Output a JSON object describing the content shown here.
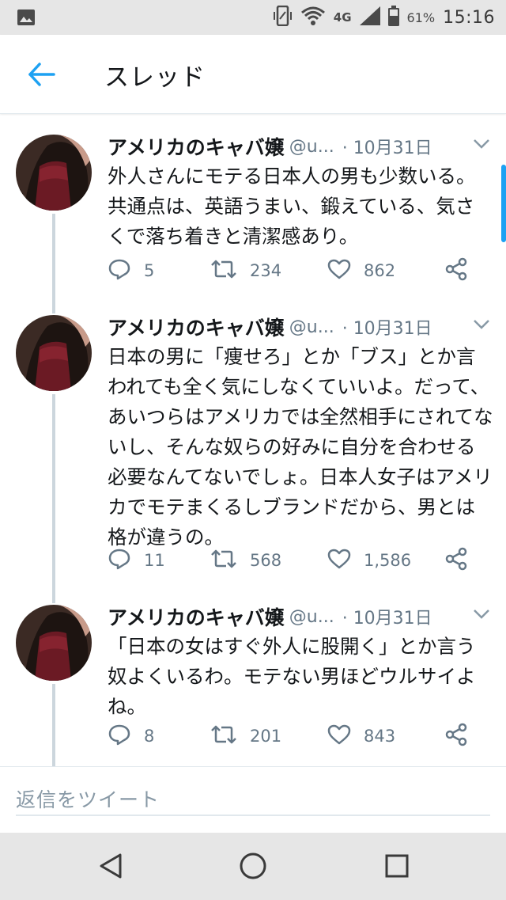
{
  "status_bar": {
    "network": "4G",
    "battery": "61%",
    "time": "15:16"
  },
  "header": {
    "back_icon": "arrow-left-icon",
    "title": "スレッド"
  },
  "colors": {
    "accent": "#1da1f2",
    "text": "#14171a",
    "muted": "#657786",
    "thread_line": "#ccd6dd"
  },
  "tweets": [
    {
      "name": "アメリカのキャバ嬢",
      "handle": "@u...",
      "date": "· 10月31日",
      "text": "外人さんにモテる日本人の男も少数いる。共通点は、英語うまい、鍛えている、気さくで落ち着きと清潔感あり。",
      "replies": "5",
      "retweets": "234",
      "likes": "862"
    },
    {
      "name": "アメリカのキャバ嬢",
      "handle": "@u...",
      "date": "· 10月31日",
      "text": "日本の男に「痩せろ」とか「ブス」とか言われても全く気にしなくていいよ。だって、あいつらはアメリカでは全然相手にされてないし、そんな奴らの好みに自分を合わせる必要なんてないでしょ。日本人女子はアメリカでモテまくるしブランドだから、男とは格が違うの。",
      "replies": "11",
      "retweets": "568",
      "likes": "1,586"
    },
    {
      "name": "アメリカのキャバ嬢",
      "handle": "@u...",
      "date": "· 10月31日",
      "text": "「日本の女はすぐ外人に股開く」とか言う奴よくいるわ。モテない男ほどウルサイよね。",
      "replies": "8",
      "retweets": "201",
      "likes": "843"
    }
  ],
  "reply_bar": {
    "placeholder": "返信をツイート"
  },
  "nav_bar": {
    "back_icon": "triangle-back-icon",
    "home_icon": "circle-home-icon",
    "recents_icon": "square-recents-icon"
  }
}
